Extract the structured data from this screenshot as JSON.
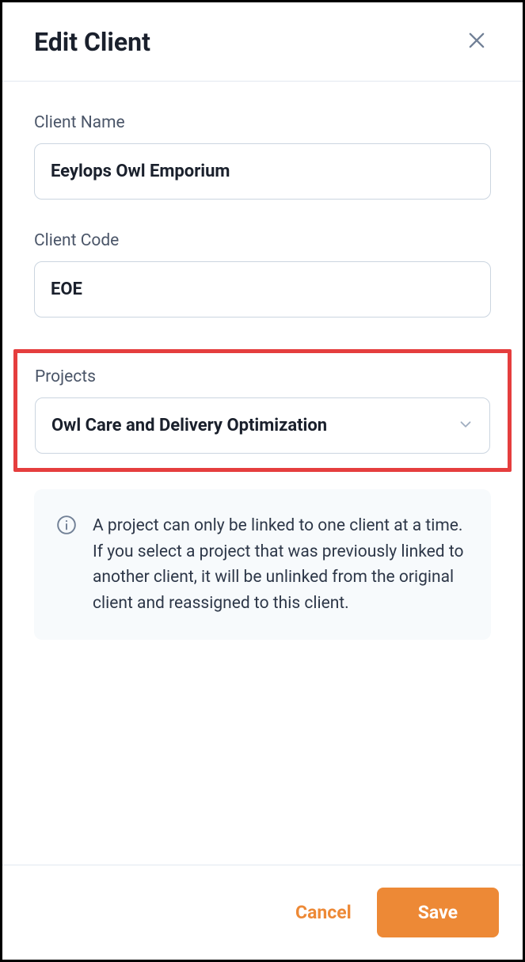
{
  "header": {
    "title": "Edit Client"
  },
  "fields": {
    "client_name": {
      "label": "Client Name",
      "value": "Eeylops Owl Emporium"
    },
    "client_code": {
      "label": "Client Code",
      "value": "EOE"
    },
    "projects": {
      "label": "Projects",
      "selected": "Owl Care and Delivery Optimization"
    }
  },
  "info": {
    "text": "A project can only be linked to one client at a time. If you select a project that was previously linked to another client, it will be unlinked from the original client and reassigned to this client."
  },
  "footer": {
    "cancel_label": "Cancel",
    "save_label": "Save"
  }
}
